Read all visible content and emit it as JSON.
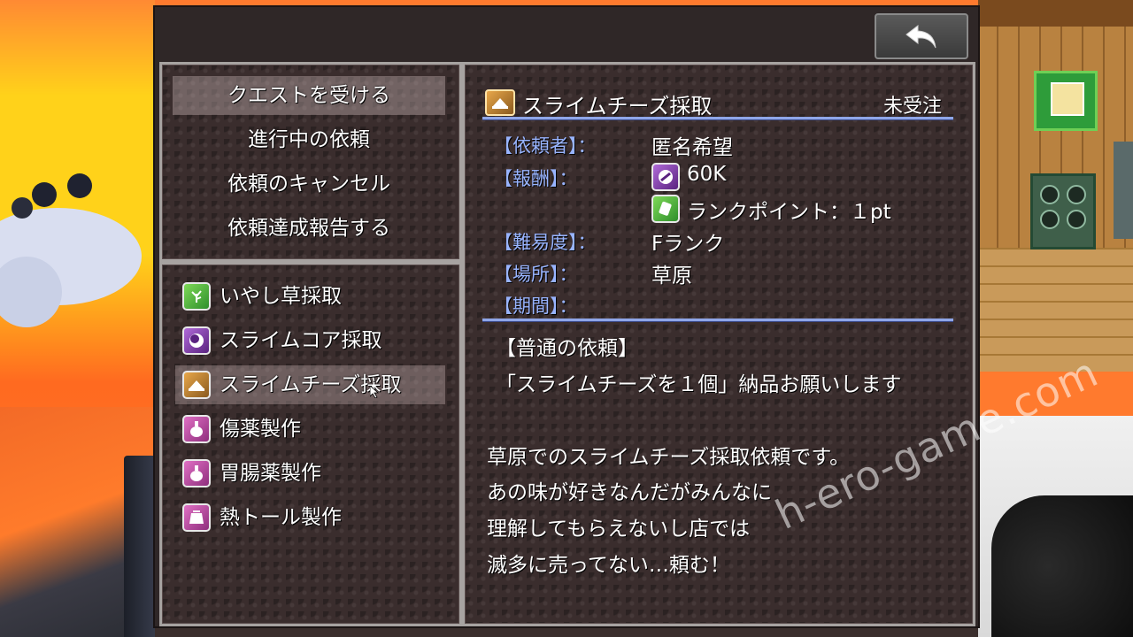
{
  "commands": [
    {
      "label": "クエストを受ける",
      "selected": true
    },
    {
      "label": "進行中の依頼"
    },
    {
      "label": "依頼のキャンセル"
    },
    {
      "label": "依頼達成報告する"
    }
  ],
  "quests": [
    {
      "label": "いやし草採取",
      "icon": "herb-icon"
    },
    {
      "label": "スライムコア採取",
      "icon": "slime-core-icon"
    },
    {
      "label": "スライムチーズ採取",
      "icon": "cheese-icon",
      "selected": true
    },
    {
      "label": "傷薬製作",
      "icon": "potion-icon"
    },
    {
      "label": "胃腸薬製作",
      "icon": "potion-icon"
    },
    {
      "label": "熱トール製作",
      "icon": "pouch-icon"
    }
  ],
  "detail": {
    "title": "スライムチーズ採取",
    "status": "未受注",
    "fields": {
      "client_label": "【依頼者】：",
      "client_value": "匿名希望",
      "reward_label": "【報酬】：",
      "reward_money": "60K",
      "reward_rank": "ランクポイント：１pt",
      "difficulty_label": "【難易度】：",
      "difficulty_value": "Fランク",
      "location_label": "【場所】：",
      "location_value": "草原",
      "period_label": "【期間】：",
      "period_value": ""
    },
    "description": [
      "【普通の依頼】",
      "「スライムチーズを１個」納品お願いします",
      "",
      "草原でのスライムチーズ採取依頼です。",
      "あの味が好きなんだがみんなに",
      "理解してもらえないし店では",
      "滅多に売ってない…頼む！"
    ]
  },
  "watermark": "h-ero-game.com",
  "colors": {
    "label_blue": "#98b4ff",
    "rule_blue": "#8fa6e8",
    "panel_bg": "#3a2d2d",
    "panel_border": "#a7a3a1"
  }
}
